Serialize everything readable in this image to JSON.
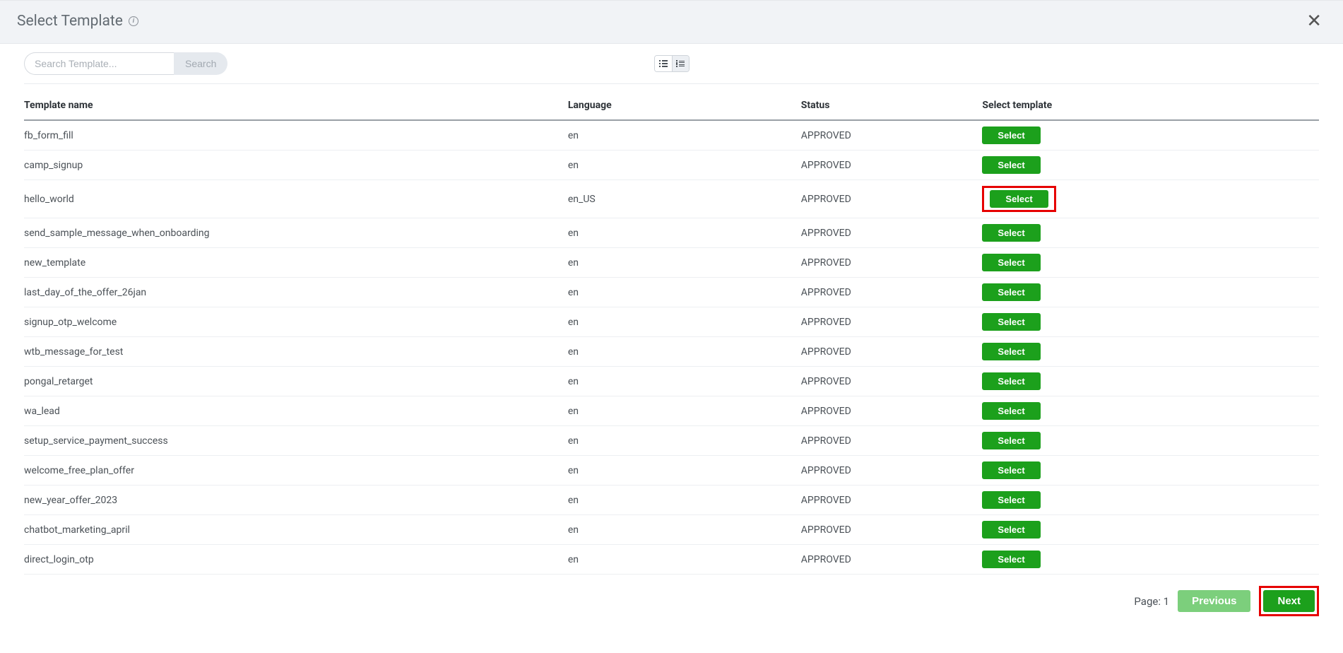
{
  "header": {
    "title": "Select Template"
  },
  "controls": {
    "search": {
      "placeholder": "Search Template...",
      "value": "",
      "button": "Search"
    }
  },
  "table": {
    "columns": {
      "name": "Template name",
      "language": "Language",
      "status": "Status",
      "select": "Select template"
    },
    "select_label": "Select",
    "rows": [
      {
        "name": "fb_form_fill",
        "language": "en",
        "status": "APPROVED",
        "highlight": false
      },
      {
        "name": "camp_signup",
        "language": "en",
        "status": "APPROVED",
        "highlight": false
      },
      {
        "name": "hello_world",
        "language": "en_US",
        "status": "APPROVED",
        "highlight": true
      },
      {
        "name": "send_sample_message_when_onboarding",
        "language": "en",
        "status": "APPROVED",
        "highlight": false
      },
      {
        "name": "new_template",
        "language": "en",
        "status": "APPROVED",
        "highlight": false
      },
      {
        "name": "last_day_of_the_offer_26jan",
        "language": "en",
        "status": "APPROVED",
        "highlight": false
      },
      {
        "name": "signup_otp_welcome",
        "language": "en",
        "status": "APPROVED",
        "highlight": false
      },
      {
        "name": "wtb_message_for_test",
        "language": "en",
        "status": "APPROVED",
        "highlight": false
      },
      {
        "name": "pongal_retarget",
        "language": "en",
        "status": "APPROVED",
        "highlight": false
      },
      {
        "name": "wa_lead",
        "language": "en",
        "status": "APPROVED",
        "highlight": false
      },
      {
        "name": "setup_service_payment_success",
        "language": "en",
        "status": "APPROVED",
        "highlight": false
      },
      {
        "name": "welcome_free_plan_offer",
        "language": "en",
        "status": "APPROVED",
        "highlight": false
      },
      {
        "name": "new_year_offer_2023",
        "language": "en",
        "status": "APPROVED",
        "highlight": false
      },
      {
        "name": "chatbot_marketing_april",
        "language": "en",
        "status": "APPROVED",
        "highlight": false
      },
      {
        "name": "direct_login_otp",
        "language": "en",
        "status": "APPROVED",
        "highlight": false
      }
    ]
  },
  "pagination": {
    "page_label": "Page: 1",
    "previous": "Previous",
    "next": "Next"
  }
}
